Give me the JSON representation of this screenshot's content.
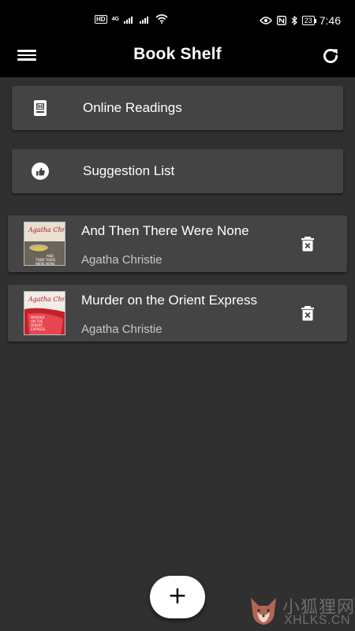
{
  "status_bar": {
    "hd_badge": "HD",
    "network": "4G",
    "battery": "23",
    "time": "7:46"
  },
  "app_bar": {
    "title": "Book Shelf"
  },
  "menu": [
    {
      "label": "Online Readings",
      "icon": "book-reader-icon"
    },
    {
      "label": "Suggestion List",
      "icon": "thumb-up-icon"
    }
  ],
  "books": [
    {
      "title": "And Then There Were None",
      "author": "Agatha Christie",
      "cover_series": "Agatha Christie",
      "cover_title": "AND THEN THERE WERE NONE"
    },
    {
      "title": "Murder on the Orient Express",
      "author": "Agatha Christie",
      "cover_series": "Agatha Christie",
      "cover_title": "MURDER ON THE ORIENT EXPRESS"
    }
  ],
  "fab": {
    "label": "+"
  },
  "watermark": {
    "cn": "小狐狸网",
    "en": "XHLKS.CN"
  },
  "colors": {
    "background": "#303030",
    "app_bar": "#000000",
    "card": "#444444",
    "fab": "#ffffff"
  }
}
